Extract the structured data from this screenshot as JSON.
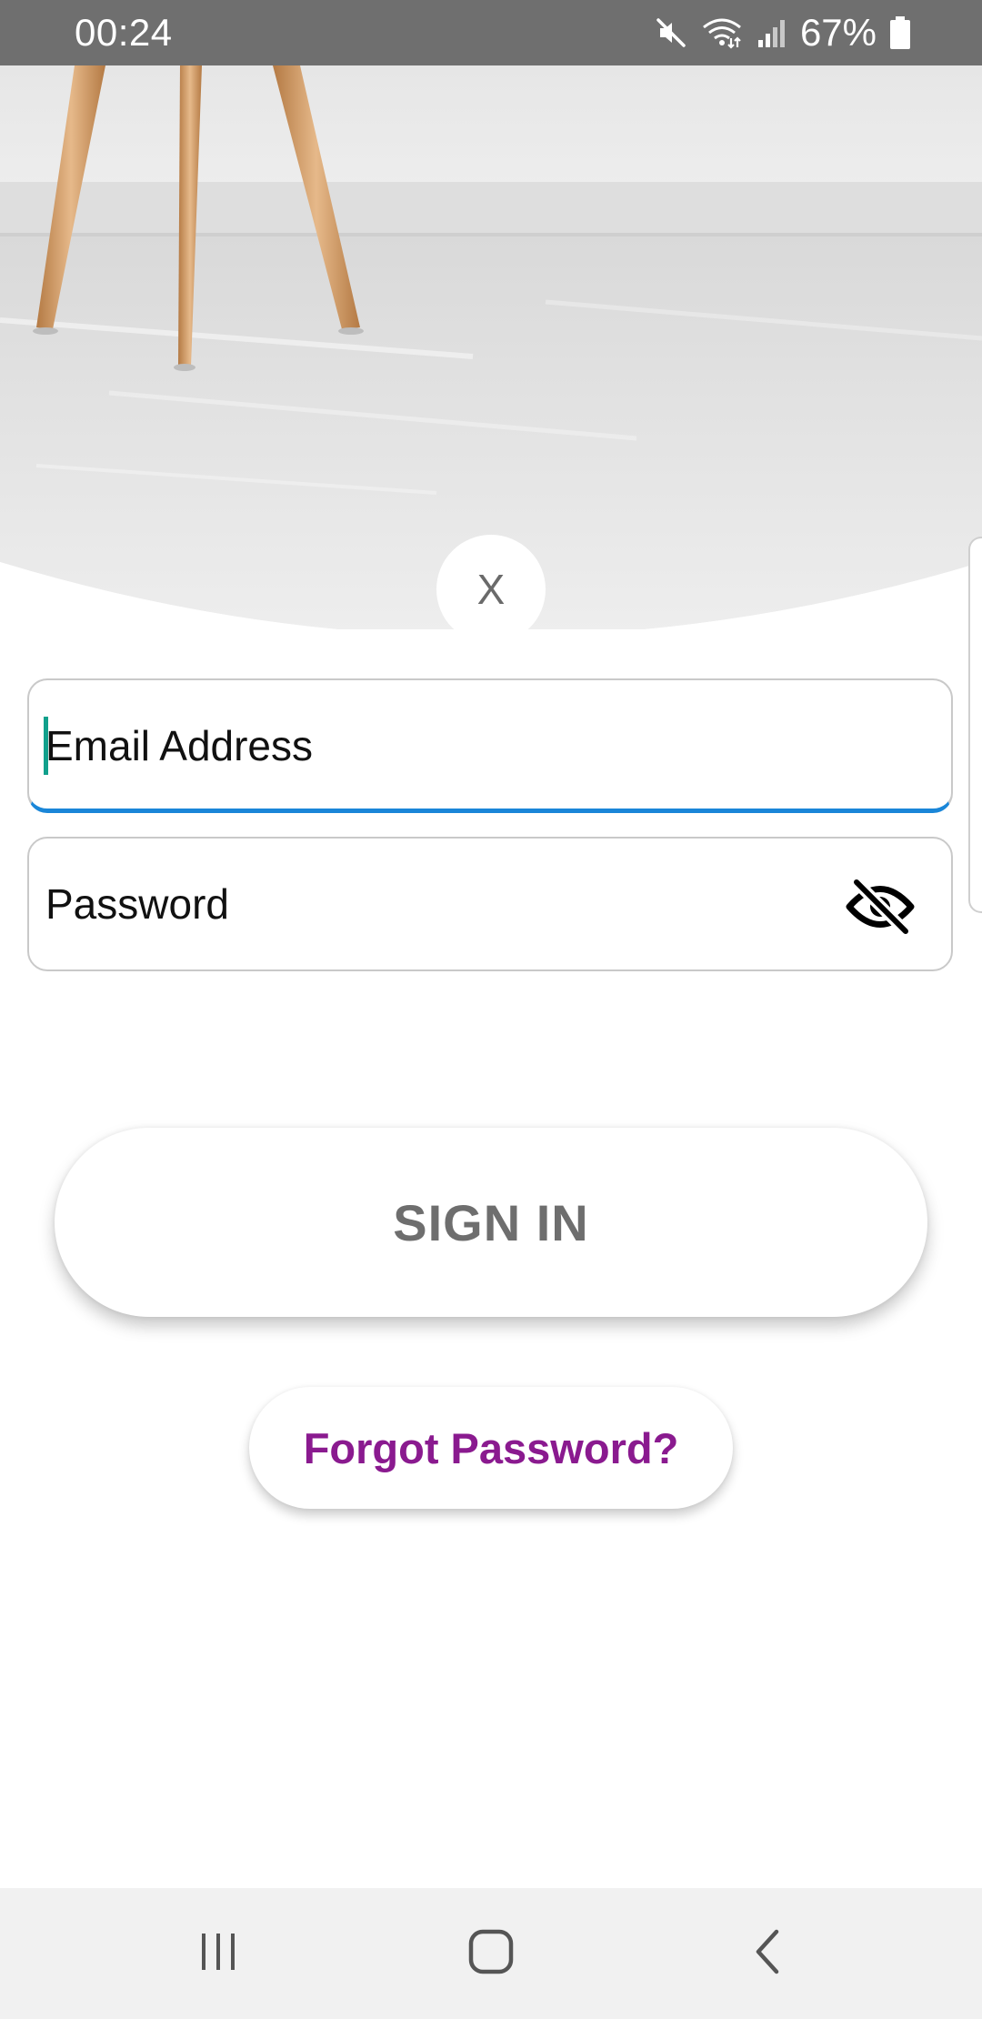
{
  "status_bar": {
    "time": "00:24",
    "battery": "67%",
    "icons": [
      "mute-icon",
      "wifi-icon",
      "signal-icon",
      "battery-icon"
    ]
  },
  "close_button": {
    "label": "X"
  },
  "form": {
    "email_placeholder": "Email Address",
    "password_placeholder": "Password",
    "password_visibility_icon": "eye-off-icon"
  },
  "buttons": {
    "sign_in": "SIGN IN",
    "forgot_password": "Forgot Password?"
  },
  "navigation": {
    "icons": [
      "recent-apps-icon",
      "home-icon",
      "back-icon"
    ]
  },
  "colors": {
    "status_bar": "#6f6f6f",
    "email_focus_underline": "#1a86d8",
    "caret": "#11a08c",
    "forgot_password_text": "#8a1a8f",
    "sign_in_text": "#6e6e6e",
    "navigation_bar": "#f1f1f1"
  }
}
